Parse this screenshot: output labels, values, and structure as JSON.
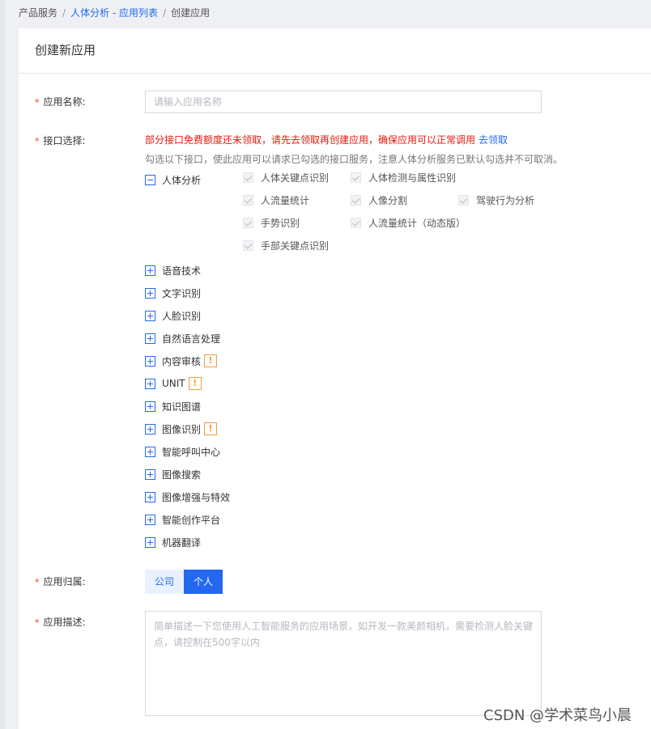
{
  "breadcrumb": {
    "item1": "产品服务",
    "sep": "/",
    "item2": "人体分析 - 应用列表",
    "item3": "创建应用"
  },
  "panel": {
    "title": "创建新应用"
  },
  "form": {
    "required_mark": "*",
    "app_name": {
      "label": "应用名称:",
      "placeholder": "请输入应用名称"
    },
    "api_select": {
      "label": "接口选择:",
      "warning": "部分接口免费额度还未领取，请先去领取再创建应用，确保应用可以正常调用",
      "warning_link": "去领取",
      "hint": "勾选以下接口，使此应用可以请求已勾选的接口服务，注意人体分析服务已默认勾选并不可取消。",
      "expanded_group": {
        "name": "人体分析",
        "items": [
          "人体关键点识别",
          "人体检测与属性识别",
          "人流量统计",
          "人像分割",
          "驾驶行为分析",
          "手势识别",
          "人流量统计（动态版）",
          "手部关键点识别"
        ]
      },
      "groups": [
        {
          "name": "语音技术",
          "badge": ""
        },
        {
          "name": "文字识别",
          "badge": ""
        },
        {
          "name": "人脸识别",
          "badge": ""
        },
        {
          "name": "自然语言处理",
          "badge": ""
        },
        {
          "name": "内容审核",
          "badge": "!"
        },
        {
          "name": "UNIT",
          "badge": "!"
        },
        {
          "name": "知识图谱",
          "badge": ""
        },
        {
          "name": "图像识别",
          "badge": "!"
        },
        {
          "name": "智能呼叫中心",
          "badge": ""
        },
        {
          "name": "图像搜索",
          "badge": ""
        },
        {
          "name": "图像增强与特效",
          "badge": ""
        },
        {
          "name": "智能创作平台",
          "badge": ""
        },
        {
          "name": "机器翻译",
          "badge": ""
        }
      ]
    },
    "ownership": {
      "label": "应用归属:",
      "options": [
        "公司",
        "个人"
      ],
      "selected": "个人"
    },
    "description": {
      "label": "应用描述:",
      "placeholder": "简单描述一下您使用人工智能服务的应用场景，如开发一款美颜相机，需要检测人脸关键点，请控制在500字以内"
    }
  },
  "watermark": "CSDN @学术菜鸟小晨",
  "colors": {
    "link": "#2468f2",
    "warning": "#e8180c",
    "required": "#e8402b",
    "badge": "#f39c3b"
  }
}
